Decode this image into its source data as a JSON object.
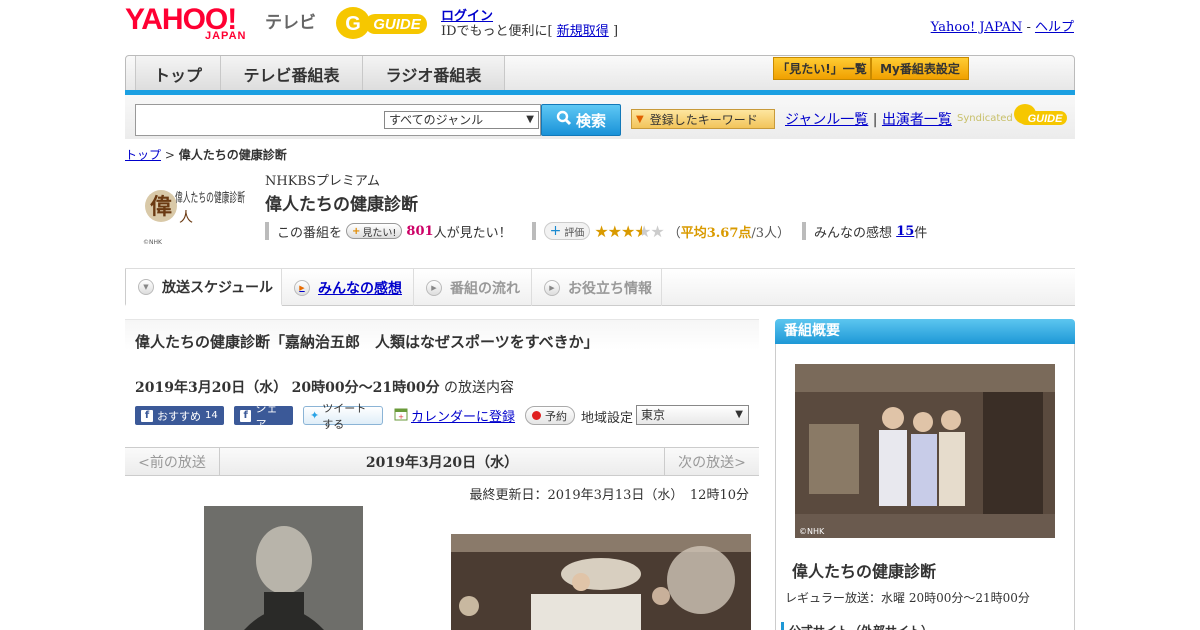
{
  "header": {
    "yahoo_logo": "YAHOO!",
    "japan_sub": "JAPAN",
    "tv_label": "テレビ",
    "gguide_logo": "G-GUIDE",
    "login": "ログイン",
    "id_prefix": "IDでもっと便利に[",
    "signup": "新規取得",
    "id_suffix": "]",
    "yahoo_japan_link": "Yahoo! JAPAN",
    "separator": "-",
    "help_link": "ヘルプ"
  },
  "nav": {
    "tabs": [
      "トップ",
      "テレビ番組表",
      "ラジオ番組表"
    ],
    "mitai_list": "「見たい!」一覧",
    "my_schedule": "My番組表設定"
  },
  "search": {
    "input_value": "",
    "genre_selected": "すべてのジャンル",
    "search_button": "検索",
    "keyword_button": "登録したキーワード",
    "genre_list": "ジャンル一覧",
    "link_sep": "|",
    "performer_list": "出演者一覧",
    "syndicated": "Syndicated"
  },
  "breadcrumb": {
    "top": "トップ",
    "sep": ">",
    "current": "偉人たちの健康診断"
  },
  "program": {
    "logo_text": "偉人たちの健康診断",
    "logo_credit": "©NHK",
    "channel": "NHKBSプレミアム",
    "title": "偉人たちの健康診断",
    "mitai_prefix": "この番組を",
    "mitai_button": "見たい!",
    "mitai_count": "801",
    "mitai_suffix": "人が見たい！",
    "rating_button": "評価",
    "rating_value": 3.67,
    "rating_open": "（",
    "rating_avg_label": "平均3.67点",
    "rating_people": "/3人）",
    "impressions_label": "みんなの感想",
    "impressions_count": "15",
    "impressions_unit": "件"
  },
  "tabs": [
    {
      "label": "放送スケジュール",
      "state": "active"
    },
    {
      "label": "みんなの感想",
      "state": "link"
    },
    {
      "label": "番組の流れ",
      "state": "disabled"
    },
    {
      "label": "お役立ち情報",
      "state": "disabled"
    }
  ],
  "episode": {
    "title": "偉人たちの健康診断「嘉納治五郎　人類はなぜスポーツをすべきか」",
    "date": "2019年3月20日（水）",
    "time": "20時00分～21時00分",
    "suffix": "の放送内容",
    "fb_recommend": "おすすめ",
    "fb_recommend_count": "14",
    "fb_share": "シェア",
    "tweet": "ツイートする",
    "calendar": "カレンダーに登録",
    "reserve": "予約",
    "region_label": "地域設定",
    "region_selected": "東京",
    "prev": "<前の放送",
    "pager_date": "2019年3月20日（水）",
    "next": "次の放送>",
    "updated": "最終更新日：2019年3月13日（水）　12時10分"
  },
  "sidebar": {
    "heading": "番組概要",
    "image_credit": "©NHK",
    "title": "偉人たちの健康診断",
    "regular": "レギュラー放送：水曜 20時00分～21時00分",
    "official_site": "公式サイト（外部サイト）"
  },
  "colors": {
    "accent_blue": "#1ca0e2",
    "yahoo_red": "#ff0033",
    "gguide_yellow": "#f6c700",
    "star": "#d99a00",
    "count_pink": "#cc0066"
  },
  "icons": [
    "search-icon",
    "star-icon",
    "plus-icon",
    "facebook-icon",
    "twitter-icon",
    "calendar-icon",
    "record-icon",
    "triangle-down-icon",
    "play-icon"
  ]
}
